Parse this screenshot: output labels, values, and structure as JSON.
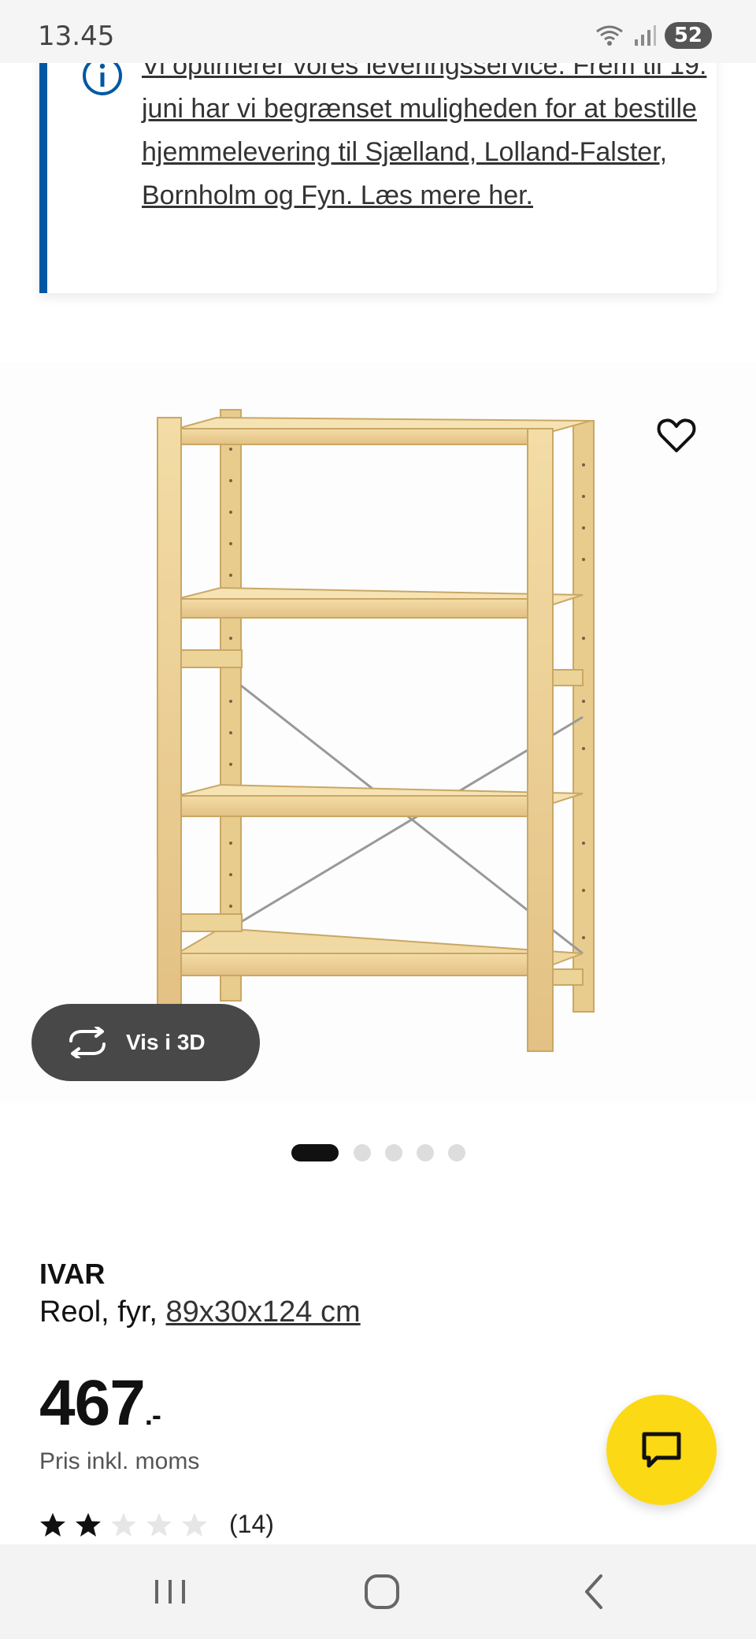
{
  "status_bar": {
    "time": "13.45",
    "battery": "52"
  },
  "notice": {
    "text": "Vi optimerer vores leveringsservice. Frem til 19. juni har vi begrænset muligheden for at bestille hjemmelevering til Sjælland, Lolland-Falster, Bornholm og Fyn. Læs mere her."
  },
  "product": {
    "name": "IVAR",
    "description_prefix": "Reol, fyr, ",
    "measurements": "89x30x124 cm",
    "price": "467",
    "price_suffix": ".-",
    "price_note": "Pris inkl. moms",
    "rating": {
      "value": 2,
      "max": 5,
      "count": "(14)"
    }
  },
  "buttons": {
    "view_3d": "Vis i 3D"
  },
  "carousel": {
    "total": 5,
    "active": 1
  },
  "colors": {
    "accent_blue": "#0058a3",
    "chat_yellow": "#fbd914",
    "dark_button": "#484848"
  },
  "icons": [
    "info-icon",
    "heart-icon",
    "rotate-3d-icon",
    "chat-icon",
    "star-icon",
    "recent-apps-icon",
    "home-icon",
    "back-icon"
  ]
}
